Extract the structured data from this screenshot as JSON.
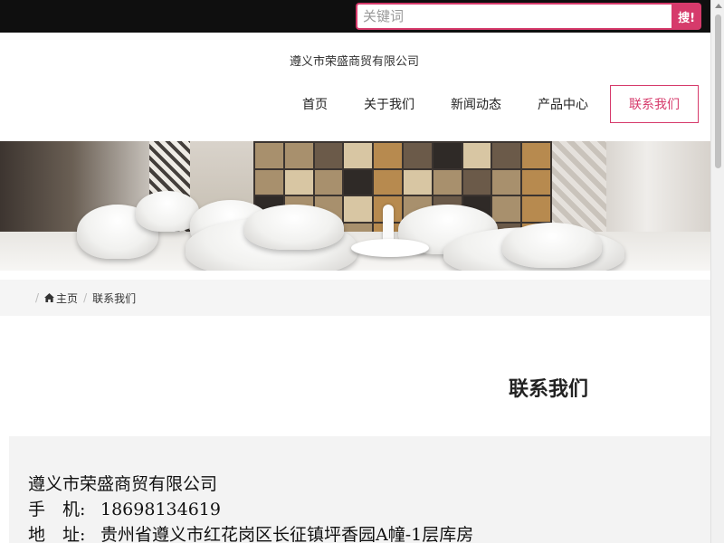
{
  "search": {
    "placeholder": "关键词",
    "button_label": "搜!"
  },
  "header": {
    "company_name": "遵义市荣盛商贸有限公司"
  },
  "nav": {
    "items": [
      {
        "label": "首页"
      },
      {
        "label": "关于我们"
      },
      {
        "label": "新闻动态"
      },
      {
        "label": "产品中心"
      },
      {
        "label": "联系我们",
        "active": true
      }
    ]
  },
  "breadcrumb": {
    "home": "主页",
    "current": "联系我们"
  },
  "main": {
    "title": "联系我们",
    "company": "遵义市荣盛商贸有限公司",
    "phone_label": "手　机:",
    "phone": "18698134619",
    "address_label": "地　址:",
    "address": "贵州省遵义市红花岗区长征镇坪香园A幢-1层库房"
  },
  "colors": {
    "accent": "#d63a6b",
    "topbar": "#0f0f0f",
    "breadcrumb_bg": "#f5f5f5"
  }
}
